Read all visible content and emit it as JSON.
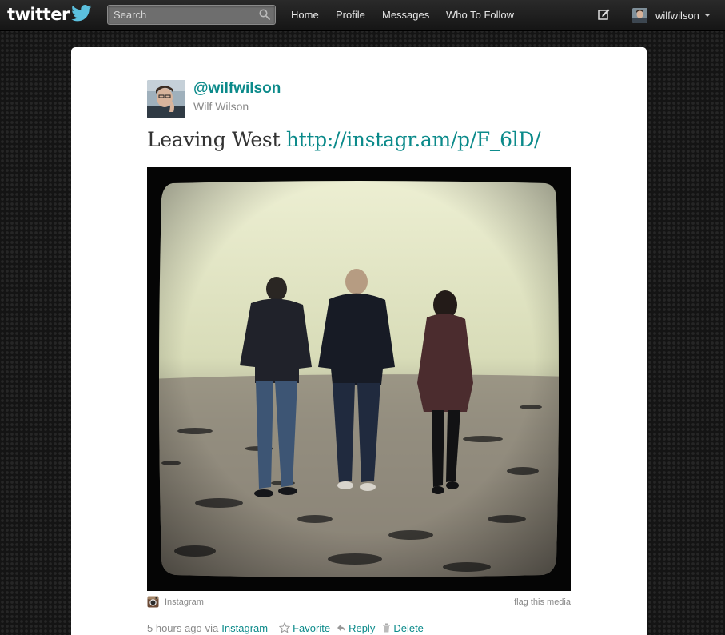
{
  "topbar": {
    "logo_text": "twitter",
    "search_placeholder": "Search",
    "nav": [
      "Home",
      "Profile",
      "Messages",
      "Who To Follow"
    ],
    "username": "wilfwilson"
  },
  "tweet": {
    "handle": "@wilfwilson",
    "name": "Wilf Wilson",
    "text": "Leaving West",
    "link": "http://instagr.am/p/F_6lD/",
    "media_source": "Instagram",
    "flag_label": "flag this media",
    "time": "5 hours ago",
    "via_label": "via",
    "via_app": "Instagram",
    "actions": {
      "favorite": "Favorite",
      "reply": "Reply",
      "delete": "Delete"
    }
  },
  "colors": {
    "link": "#0b8a8a",
    "topbar": "#1c1c1c",
    "card": "#ffffff"
  },
  "icons": [
    "twitter-bird-icon",
    "search-icon",
    "compose-icon",
    "chevron-down-icon",
    "instagram-icon",
    "star-icon",
    "reply-icon",
    "trash-icon"
  ]
}
